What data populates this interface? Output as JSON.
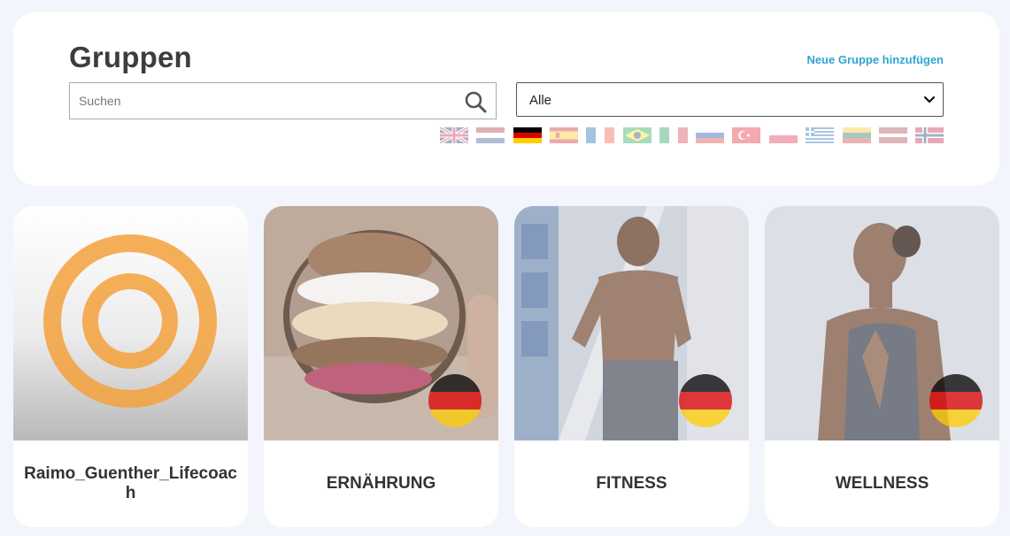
{
  "header": {
    "title": "Gruppen",
    "add_group_link": "Neue Gruppe hinzufügen"
  },
  "search": {
    "placeholder": "Suchen",
    "value": "",
    "icon": "search-icon"
  },
  "filter": {
    "selected": "Alle",
    "icon": "chevron-down-icon"
  },
  "language_flags": [
    {
      "code": "en",
      "active": false
    },
    {
      "code": "nl",
      "active": false
    },
    {
      "code": "de",
      "active": true
    },
    {
      "code": "es",
      "active": false
    },
    {
      "code": "fr",
      "active": false
    },
    {
      "code": "br",
      "active": false
    },
    {
      "code": "it",
      "active": false
    },
    {
      "code": "ru",
      "active": false
    },
    {
      "code": "tr",
      "active": false
    },
    {
      "code": "pl",
      "active": false
    },
    {
      "code": "gr",
      "active": false
    },
    {
      "code": "lt",
      "active": false
    },
    {
      "code": "lv",
      "active": false
    },
    {
      "code": "no",
      "active": false
    }
  ],
  "groups": [
    {
      "name": "Raimo_Guenther_Lifecoach",
      "image": "target-logo",
      "language_badge": null
    },
    {
      "name": "ERNÄHRUNG",
      "image": "smoothie-bowl-photo",
      "language_badge": "de"
    },
    {
      "name": "FITNESS",
      "image": "running-man-photo",
      "language_badge": "de"
    },
    {
      "name": "WELLNESS",
      "image": "meditating-woman-photo",
      "language_badge": "de"
    }
  ],
  "colors": {
    "link": "#2fa3d6",
    "logo_orange": "#f5a13c",
    "background": "#f2f5fb"
  }
}
